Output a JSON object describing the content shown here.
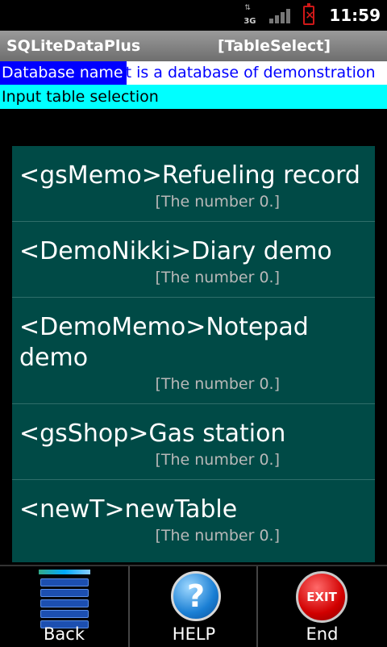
{
  "status_bar": {
    "network_type": "3G",
    "clock": "11:59"
  },
  "title_bar": {
    "app_name": "SQLiteDataPlus",
    "screen_name": "[TableSelect]"
  },
  "database": {
    "label": "Database name",
    "value": "It is a database of demonstration"
  },
  "prompt": "Input table selection",
  "tables": [
    {
      "name": "<gsMemo>Refueling record",
      "count": "[The number 0.]"
    },
    {
      "name": "<DemoNikki>Diary demo",
      "count": "[The number 0.]"
    },
    {
      "name": "<DemoMemo>Notepad demo",
      "count": "[The number 0.]"
    },
    {
      "name": "<gsShop>Gas station",
      "count": "[The number 0.]"
    },
    {
      "name": "<newT>newTable",
      "count": "[The number 0.]"
    }
  ],
  "bottom_bar": {
    "back_label": "Back",
    "help_label": "HELP",
    "end_label": "End",
    "help_icon_glyph": "?",
    "exit_icon_text": "EXIT"
  },
  "colors": {
    "db_label_bg": "#0000ff",
    "prompt_bg": "#00ffff",
    "list_bg": "#004a46"
  }
}
